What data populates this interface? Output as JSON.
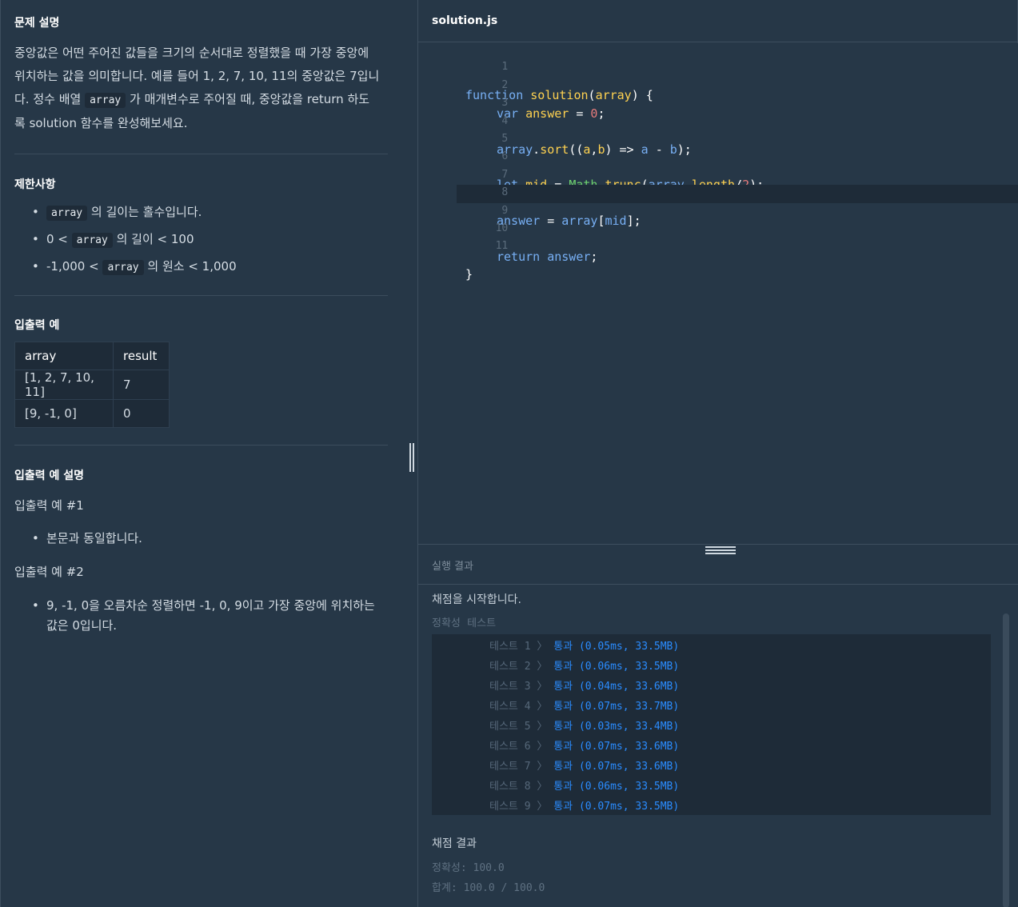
{
  "problem": {
    "desc_title": "문제 설명",
    "desc_lines": [
      "중앙값은 어떤 주어진 값들을 크기의 순서대로 정렬했을 때 가장 중앙에",
      "위치하는 값을 의미합니다. 예를 들어 1, 2, 7, 10, 11의 중앙값은 7입니",
      "다. 정수 배열",
      "array",
      "가 매개변수로 주어질 때, 중앙값을 return 하도",
      "록 solution 함수를 완성해보세요."
    ],
    "constraints_title": "제한사항",
    "constraints": [
      {
        "pre": "",
        "code": "array",
        "post": "의 길이는 홀수입니다."
      },
      {
        "pre": "0 <",
        "code": "array",
        "post": "의 길이 < 100"
      },
      {
        "pre": "-1,000 <",
        "code": "array",
        "post": "의 원소 < 1,000"
      }
    ],
    "io_title": "입출력 예",
    "io_headers": [
      "array",
      "result"
    ],
    "io_rows": [
      [
        "[1, 2, 7, 10, 11]",
        "7"
      ],
      [
        "[9, -1, 0]",
        "0"
      ]
    ],
    "io_desc_title": "입출력 예 설명",
    "ex1_title": "입출력 예 #1",
    "ex1_bullet": "본문과 동일합니다.",
    "ex2_title": "입출력 예 #2",
    "ex2_bullet_line1": "9, -1, 0을 오름차순 정렬하면 -1, 0, 9이고 가장 중앙에 위치하는",
    "ex2_bullet_line2": "값은 0입니다."
  },
  "editor": {
    "filename": "solution.js",
    "line_numbers": [
      "1",
      "2",
      "3",
      "4",
      "5",
      "6",
      "7",
      "8",
      "9",
      "10",
      "11"
    ],
    "code": {
      "l1_kw": "function",
      "l1_fn": "solution",
      "l1_p1": "(",
      "l1_param": "array",
      "l1_p2": ") {",
      "l2_kw": "var",
      "l2_var": "answer",
      "l2_eq": " = ",
      "l2_num": "0",
      "l2_end": ";",
      "l4_obj": "array",
      "l4_dot": ".",
      "l4_m": "sort",
      "l4_o": "((",
      "l4_a": "a",
      "l4_c": ",",
      "l4_b": "b",
      "l4_cl": ") ",
      "l4_arrow": "=>",
      "l4_a2": " a ",
      "l4_minus": "-",
      "l4_b2": " b",
      "l4_end": ");",
      "l6_kw": "let",
      "l6_var": "mid",
      "l6_eq": " = ",
      "l6_math": "Math",
      "l6_dot": ".",
      "l6_m": "trunc",
      "l6_o": "(",
      "l6_arr": "array",
      "l6_dot2": ".",
      "l6_len": "length",
      "l6_div": "/",
      "l6_num": "2",
      "l6_end": ");",
      "l8_var": "answer",
      "l8_eq": " = ",
      "l8_arr": "array",
      "l8_o": "[",
      "l8_mid": "mid",
      "l8_end": "];",
      "l10_kw": "return",
      "l10_var": "answer",
      "l10_end": ";",
      "l11": "}"
    }
  },
  "results": {
    "header": "실행 결과",
    "start_msg": "채점을 시작합니다.",
    "subheader": "정확성  테스트",
    "tests": [
      {
        "label": "테스트 1 〉",
        "result": "통과 (0.05ms, 33.5MB)"
      },
      {
        "label": "테스트 2 〉",
        "result": "통과 (0.06ms, 33.5MB)"
      },
      {
        "label": "테스트 3 〉",
        "result": "통과 (0.04ms, 33.6MB)"
      },
      {
        "label": "테스트 4 〉",
        "result": "통과 (0.07ms, 33.7MB)"
      },
      {
        "label": "테스트 5 〉",
        "result": "통과 (0.03ms, 33.4MB)"
      },
      {
        "label": "테스트 6 〉",
        "result": "통과 (0.07ms, 33.6MB)"
      },
      {
        "label": "테스트 7 〉",
        "result": "통과 (0.07ms, 33.6MB)"
      },
      {
        "label": "테스트 8 〉",
        "result": "통과 (0.06ms, 33.5MB)"
      },
      {
        "label": "테스트 9 〉",
        "result": "통과 (0.07ms, 33.5MB)"
      }
    ],
    "summary_title": "채점 결과",
    "accuracy": "정확성: 100.0",
    "total": "합계: 100.0 / 100.0"
  }
}
